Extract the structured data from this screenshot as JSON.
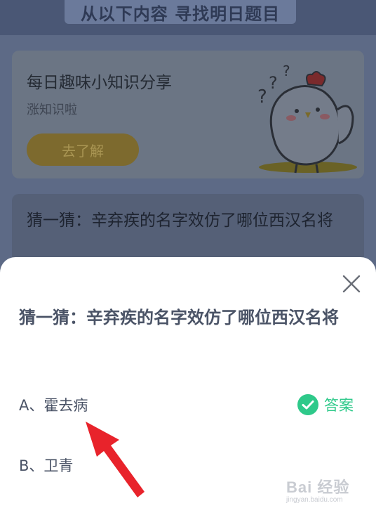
{
  "header": {
    "title": "从以下内容 寻找明日题目"
  },
  "trivia_card": {
    "title": "每日趣味小知识分享",
    "subtitle": "涨知识啦",
    "button_label": "去了解"
  },
  "question_card": {
    "text": "猜一猜：辛弃疾的名字效仿了哪位西汉名将"
  },
  "sheet": {
    "question": "猜一猜：辛弃疾的名字效仿了哪位西汉名将",
    "options": [
      {
        "label": "A、霍去病"
      },
      {
        "label": "B、卫青"
      }
    ],
    "answer_label": "答案"
  },
  "watermark": {
    "main": "Bai 经验",
    "sub": "jingyan.baidu.com"
  },
  "colors": {
    "accent_green": "#2ec98a",
    "arrow_red": "#e8232b",
    "overlay": "#5d6a86"
  }
}
